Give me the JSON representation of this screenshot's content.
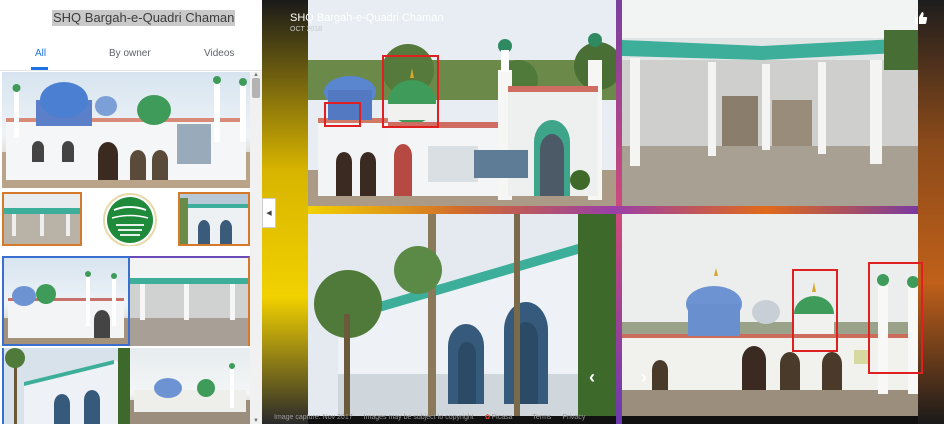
{
  "left_panel": {
    "title": "SHQ Bargah-e-Quadri Chaman",
    "tabs": [
      {
        "label": "All",
        "active": true
      },
      {
        "label": "By owner",
        "active": false
      },
      {
        "label": "Videos",
        "active": false
      }
    ]
  },
  "viewer": {
    "title": "SHQ Bargah-e-Quadri Chaman",
    "date": "OCT 2018",
    "footer": {
      "capture": "Image capture: Nov 2017",
      "copyright": "Images may be subject to copyright",
      "brand": "Picasa",
      "terms": "Terms",
      "privacy": "Privacy"
    },
    "prev_arrow": "‹",
    "next_arrow": "›"
  },
  "colors": {
    "accent": "#1a73e8",
    "annotation": "#e02020",
    "dome_green": "#3f9b5a",
    "dome_blue": "#4b7fd1"
  },
  "icons": [
    "thumbs-up-icon",
    "chevron-left-icon",
    "chevron-right-icon",
    "collapse-icon"
  ]
}
